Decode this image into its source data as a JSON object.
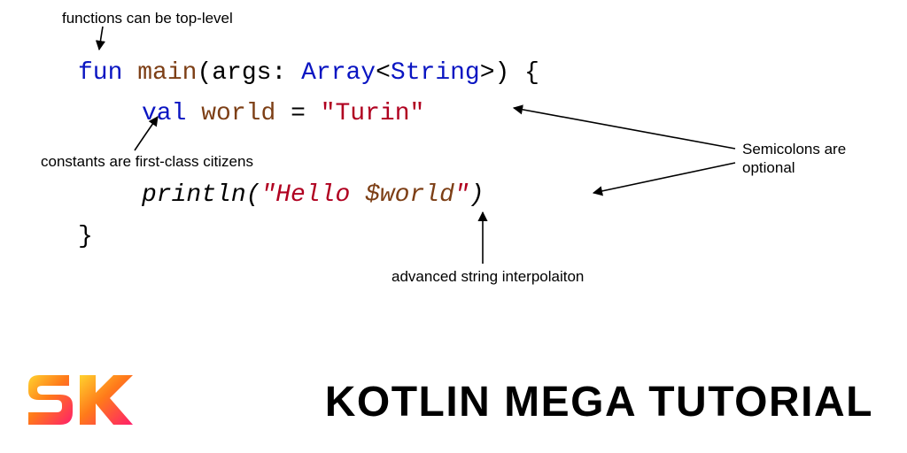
{
  "annotations": {
    "top_level": "functions can be top-level",
    "constants": "constants are first-class citizens",
    "semicolons_l1": "Semicolons are",
    "semicolons_l2": "optional",
    "interp": "advanced string interpolaiton"
  },
  "code": {
    "fun": "fun",
    "main": "main",
    "lparen_args": "(args:",
    "array": "Array",
    "lt": "<",
    "string": "String",
    "gt_close": ">) {",
    "val": "val",
    "world": "world",
    "eq": "=",
    "str_turin": "\"Turin\"",
    "println": "println",
    "call_open": "(",
    "str_open": "\"Hello ",
    "dollar_world": "$world",
    "str_close": "\"",
    "call_close": ")",
    "rbrace": "}"
  },
  "title": "Kotlin Mega Tutorial",
  "logo": {
    "alt": "SK"
  }
}
